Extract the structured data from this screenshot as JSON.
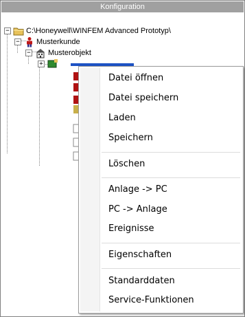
{
  "panel": {
    "title": "Konfiguration"
  },
  "tree": {
    "root": {
      "label": "C:\\Honeywell\\WINFEM Advanced Prototyp\\",
      "icon": "folder-icon"
    },
    "customer": {
      "label": "Musterkunde",
      "icon": "person-icon"
    },
    "object": {
      "label": "Musterobjekt",
      "icon": "building-icon"
    }
  },
  "context_menu": {
    "items": [
      "Datei öffnen",
      "Datei speichern",
      "Laden",
      "Speichern",
      "Löschen",
      "Anlage -> PC",
      "PC -> Anlage",
      "Ereignisse",
      "Eigenschaften",
      "Standarddaten",
      "Service-Funktionen"
    ]
  },
  "colors": {
    "title_bar": "#a0a0a0",
    "selection": "#1d52c4",
    "folder": "#e8c25a",
    "person": "#c01818"
  }
}
